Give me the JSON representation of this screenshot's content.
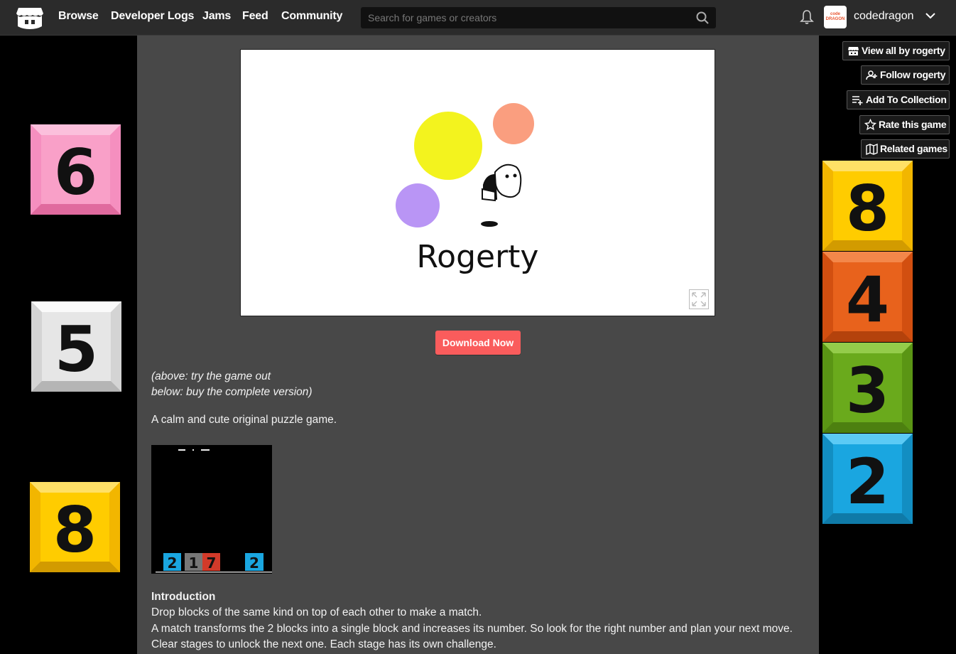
{
  "nav": {
    "links": [
      "Browse",
      "Developer Logs",
      "Jams",
      "Feed",
      "Community"
    ],
    "search_placeholder": "Search for games or creators",
    "avatar_text": "code DRAGON",
    "username": "codedragon"
  },
  "actions": {
    "view_all": "View all by rogerty",
    "follow": "Follow rogerty",
    "add_collection": "Add To Collection",
    "rate": "Rate this game",
    "related": "Related games"
  },
  "game": {
    "title": "Rogerty",
    "download_label": "Download Now"
  },
  "description": {
    "note_line1": "(above: try the game out",
    "note_line2": "below: buy the complete version)",
    "tagline": "A calm and cute original puzzle game.",
    "intro_heading": "Introduction",
    "intro_line1": "Drop blocks of the same kind on top of each other to make a match.",
    "intro_line2": "A match transforms the 2 blocks into a single block and increases its number. So look for the right number and plan your next move.",
    "intro_line3": "Clear stages to unlock the next one. Each stage has its own challenge."
  },
  "screenshot_blocks": [
    "2",
    "1",
    "7",
    "2"
  ],
  "tiles": {
    "left": [
      {
        "label": "6",
        "color": "#f9a0c8"
      },
      {
        "label": "5",
        "color": "#e6e6e6"
      },
      {
        "label": "8",
        "color": "#ffcc00"
      }
    ],
    "right": [
      {
        "label": "8",
        "color": "#ffcc00"
      },
      {
        "label": "4",
        "color": "#e8621c"
      },
      {
        "label": "3",
        "color": "#6aaa1c"
      },
      {
        "label": "2",
        "color": "#1aa6e0"
      }
    ]
  },
  "colors": {
    "accent": "#fa5c5c",
    "topbar": "#2b2b2b",
    "main_bg": "#484848"
  }
}
